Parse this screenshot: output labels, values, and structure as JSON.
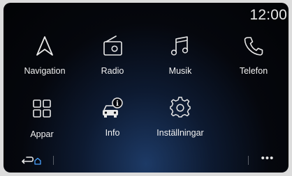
{
  "status": {
    "time": "12:00"
  },
  "apps": [
    {
      "label": "Navigation",
      "icon": "navigation-arrow-icon"
    },
    {
      "label": "Radio",
      "icon": "radio-icon"
    },
    {
      "label": "Musik",
      "icon": "music-note-icon"
    },
    {
      "label": "Telefon",
      "icon": "phone-icon"
    },
    {
      "label": "Appar",
      "icon": "apps-grid-icon"
    },
    {
      "label": "Info",
      "icon": "car-info-icon"
    },
    {
      "label": "Inställningar",
      "icon": "gear-icon"
    }
  ],
  "bottom_bar": {
    "back_icon": "back-home-icon",
    "more_icon": "more-dots-icon",
    "more_label": "•••"
  },
  "colors": {
    "background": "#05070d",
    "accent_glow": "#1d3a66",
    "text": "#ffffff",
    "home_accent": "#4aa3ff"
  }
}
